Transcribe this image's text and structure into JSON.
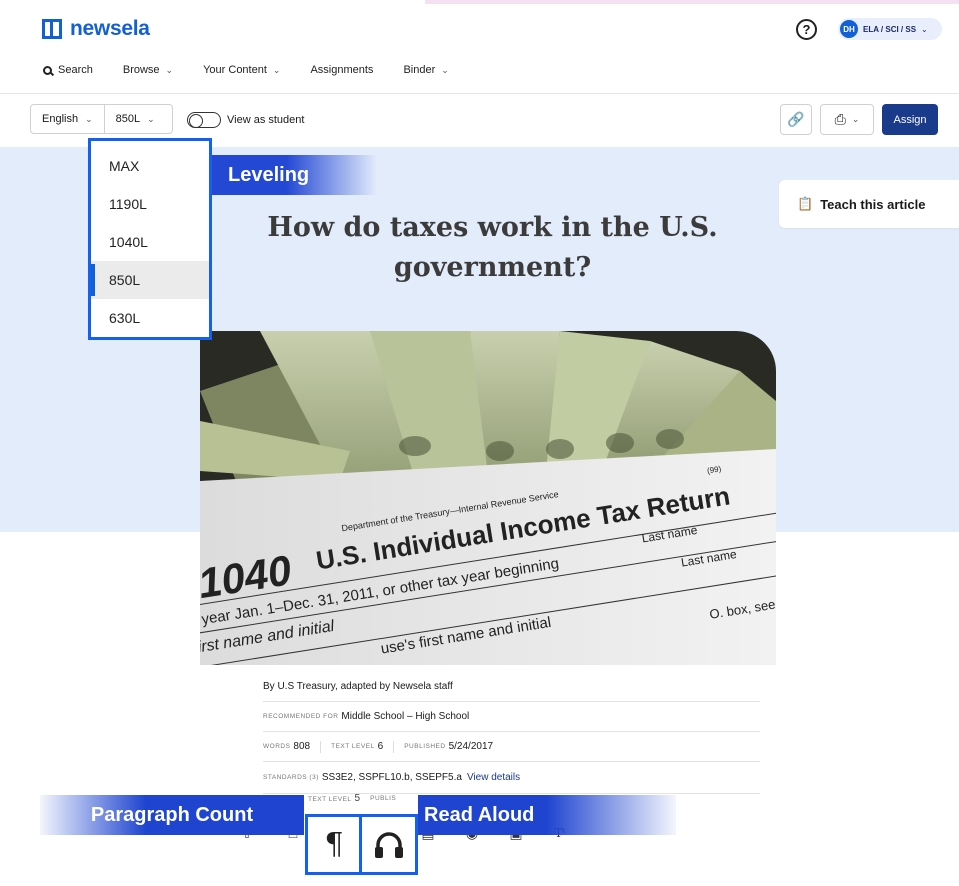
{
  "app": {
    "logo_text": "newsela"
  },
  "header": {
    "help_symbol": "?",
    "user": {
      "initials": "DH",
      "label": "ELA / SCI / SS"
    }
  },
  "nav": {
    "items": [
      {
        "label": "Search",
        "icon": "search-icon"
      },
      {
        "label": "Browse",
        "has_chevron": true
      },
      {
        "label": "Your Content",
        "has_chevron": true
      },
      {
        "label": "Assignments"
      },
      {
        "label": "Binder",
        "has_chevron": true
      }
    ]
  },
  "toolbar": {
    "language": "English",
    "level": "850L",
    "view_as_student_label": "View as student",
    "view_as_student_on": false,
    "assign_label": "Assign"
  },
  "sidebar": {
    "teach_label": "Teach this article"
  },
  "article": {
    "title": "How do taxes work in the U.S. government?",
    "byline": "By U.S Treasury, adapted by Newsela staff",
    "recommended_label": "RECOMMENDED FOR",
    "recommended_value": "Middle School – High School",
    "words_label": "WORDS",
    "words_value": "808",
    "text_level_label": "TEXT LEVEL",
    "text_level_value": "6",
    "published_label": "PUBLISHED",
    "published_value": "5/24/2017",
    "standards_label": "STANDARDS (3)",
    "standards_value": "SS3E2, SSPFL10.b, SSEPF5.a",
    "view_details": "View details",
    "overlap_text_level_label": "TEXT LEVEL",
    "overlap_text_level_value": "5",
    "overlap_published_label": "PUBLIS"
  },
  "photo": {
    "form_number": "1040",
    "form_title": "U.S. Individual Income Tax Return",
    "dept_line": "Department of the Treasury—Internal Revenue Service",
    "year_line": "e year Jan. 1–Dec. 31, 2011, or other tax year beginning",
    "first_name_line": "first name and initial",
    "last_name": "Last name",
    "last_name_2": "Last name",
    "spouse_line": "use's first name and initial",
    "box_text": "O. box, see",
    "form_code": "(99)"
  },
  "dropdown": {
    "options": [
      "MAX",
      "1190L",
      "1040L",
      "850L",
      "630L"
    ],
    "selected": "850L"
  },
  "callouts": {
    "leveling": "Leveling",
    "paragraph_count": "Paragraph Count",
    "read_aloud": "Read Aloud"
  },
  "colors": {
    "brand": "#1360d6",
    "assign_bg": "#1a3a8c",
    "hero_bg": "#e3ecfb",
    "callout_blue": "#1f45d0",
    "highlight_border": "#1560f0"
  }
}
